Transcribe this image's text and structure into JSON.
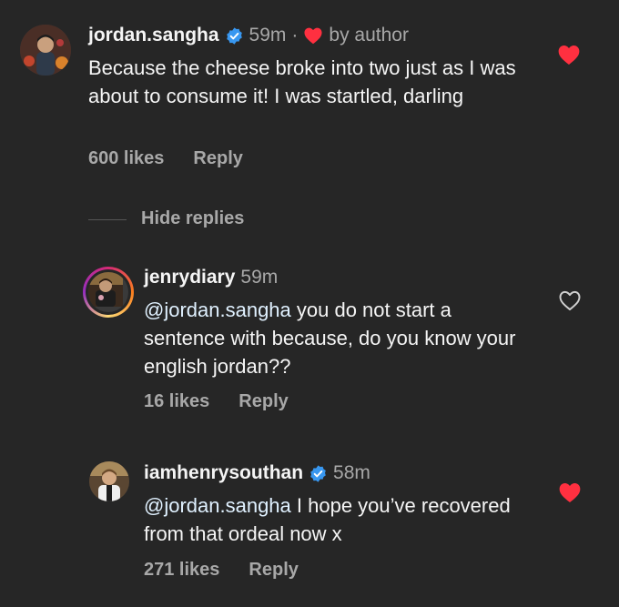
{
  "comments": [
    {
      "username": "jordan.sangha",
      "time": "59m",
      "separator": "·",
      "by_author": "by author",
      "text": "Because the cheese broke into two just as I was about to consume it! I was startled, darling",
      "likes": "600 likes",
      "reply": "Reply",
      "liked": true
    }
  ],
  "hide_replies": "Hide replies",
  "replies": [
    {
      "username": "jenrydiary",
      "time": "59m",
      "mention": "@jordan.sangha",
      "text": " you do not start a sentence with because, do you know your english jordan??",
      "likes": "16 likes",
      "reply": "Reply",
      "liked": false
    },
    {
      "username": "iamhenrysouthan",
      "time": "58m",
      "mention": "@jordan.sangha",
      "text": " I hope you’ve recovered from that ordeal now x",
      "likes": "271 likes",
      "reply": "Reply",
      "liked": true
    }
  ],
  "colors": {
    "background": "#262626",
    "text": "#f5f5f5",
    "muted": "#a8a8a8",
    "like_red": "#ff3040",
    "verified_blue": "#3897f0",
    "mention": "#e0f1ff"
  },
  "icons": {
    "verified": "verified-badge-icon",
    "heart_filled": "heart-filled-icon",
    "heart_outline": "heart-outline-icon"
  }
}
